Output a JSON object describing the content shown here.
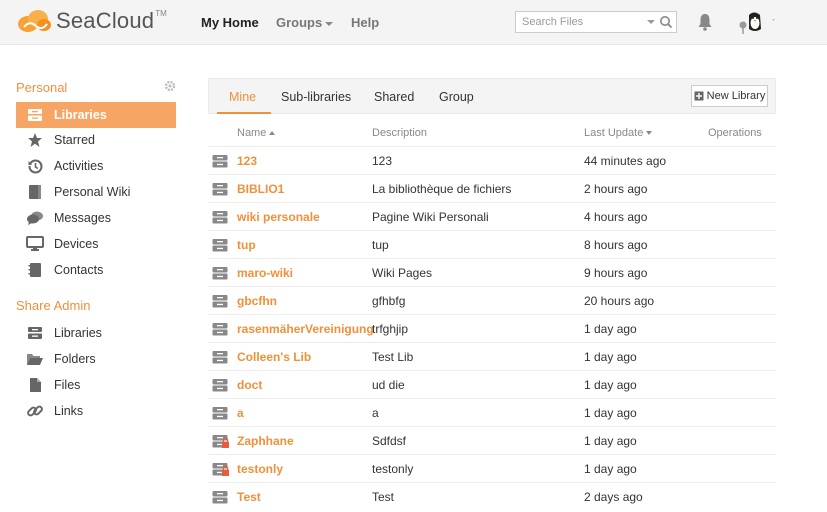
{
  "header": {
    "logo_text": "SeaCloud",
    "logo_tm": "TM",
    "nav": {
      "my_home": "My Home",
      "groups": "Groups",
      "help": "Help"
    },
    "search": {
      "placeholder": "Search Files"
    }
  },
  "sidebar": {
    "personal_title": "Personal",
    "personal_items": [
      {
        "label": "Libraries",
        "icon": "libraries-icon",
        "active": true
      },
      {
        "label": "Starred",
        "icon": "star-icon"
      },
      {
        "label": "Activities",
        "icon": "history-icon"
      },
      {
        "label": "Personal Wiki",
        "icon": "wiki-icon"
      },
      {
        "label": "Messages",
        "icon": "messages-icon"
      },
      {
        "label": "Devices",
        "icon": "monitor-icon"
      },
      {
        "label": "Contacts",
        "icon": "contacts-icon"
      }
    ],
    "admin_title": "Share Admin",
    "admin_items": [
      {
        "label": "Libraries",
        "icon": "libraries-icon"
      },
      {
        "label": "Folders",
        "icon": "folder-icon"
      },
      {
        "label": "Files",
        "icon": "file-icon"
      },
      {
        "label": "Links",
        "icon": "link-icon"
      }
    ]
  },
  "main": {
    "tabs": {
      "mine": "Mine",
      "sub": "Sub-libraries",
      "shared": "Shared",
      "group": "Group"
    },
    "new_library": "New Library",
    "columns": {
      "name": "Name",
      "description": "Description",
      "last_update": "Last Update",
      "operations": "Operations"
    },
    "libraries": [
      {
        "name": "123",
        "description": "123",
        "updated": "44 minutes ago",
        "locked": false
      },
      {
        "name": "BIBLIO1",
        "description": "La bibliothèque de fichiers",
        "updated": "2 hours ago",
        "locked": false
      },
      {
        "name": "wiki personale",
        "description": "Pagine Wiki Personali",
        "updated": "4 hours ago",
        "locked": false
      },
      {
        "name": "tup",
        "description": "tup",
        "updated": "8 hours ago",
        "locked": false
      },
      {
        "name": "maro-wiki",
        "description": "Wiki Pages",
        "updated": "9 hours ago",
        "locked": false
      },
      {
        "name": "gbcfhn",
        "description": "gfhbfg",
        "updated": "20 hours ago",
        "locked": false
      },
      {
        "name": "rasenmäherVereinigung",
        "description": "trfghjip",
        "updated": "1 day ago",
        "locked": false
      },
      {
        "name": "Colleen's Lib",
        "description": "Test Lib",
        "updated": "1 day ago",
        "locked": false
      },
      {
        "name": "doct",
        "description": "ud die",
        "updated": "1 day ago",
        "locked": false
      },
      {
        "name": "a",
        "description": "a",
        "updated": "1 day ago",
        "locked": false
      },
      {
        "name": "Zaphhane",
        "description": "Sdfdsf",
        "updated": "1 day ago",
        "locked": true
      },
      {
        "name": "testonly",
        "description": "testonly",
        "updated": "1 day ago",
        "locked": true
      },
      {
        "name": "Test",
        "description": "Test",
        "updated": "2 days ago",
        "locked": false
      }
    ]
  }
}
